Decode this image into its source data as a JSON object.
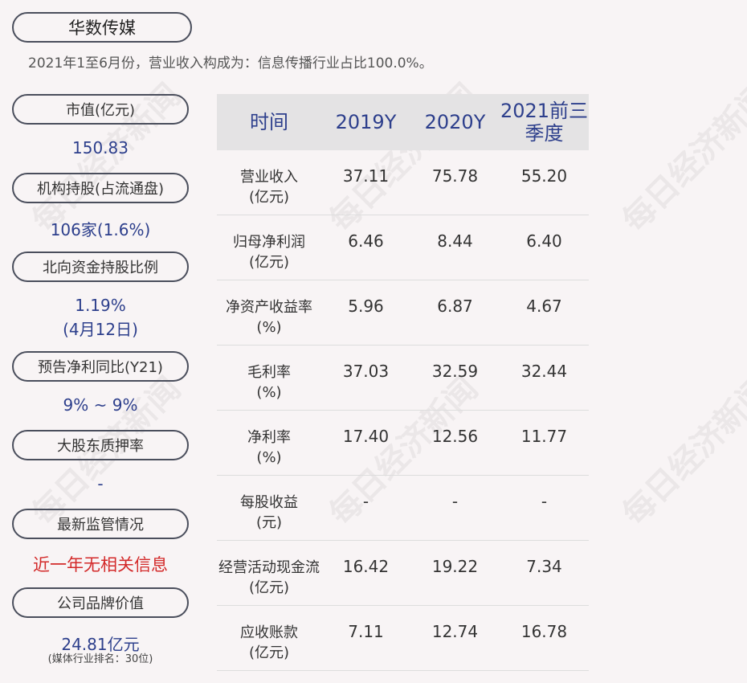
{
  "company": "华数传媒",
  "summary": "2021年1至6月份，营业收入构成为：信息传播行业占比100.0%。",
  "watermark": "每日经济新闻",
  "metrics": [
    {
      "label": "市值(亿元)",
      "value": "150.83"
    },
    {
      "label": "机构持股(占流通盘)",
      "value": "106家(1.6%)"
    },
    {
      "label": "北向资金持股比例",
      "value": "1.19%",
      "value2": "(4月12日)"
    },
    {
      "label": "预告净利同比(Y21)",
      "value": "9% ~ 9%"
    },
    {
      "label": "大股东质押率",
      "value": "-"
    },
    {
      "label": "最新监管情况",
      "value": "近一年无相关信息"
    },
    {
      "label": "公司品牌价值",
      "value": "24.81亿元",
      "note": "(媒体行业排名：30位)"
    }
  ],
  "table": {
    "headers": [
      "时间",
      "2019Y",
      "2020Y",
      "2021前三季度"
    ],
    "rows": [
      {
        "name": "营业收入",
        "unit": "(亿元)",
        "values": [
          "37.11",
          "75.78",
          "55.20"
        ]
      },
      {
        "name": "归母净利润",
        "unit": "(亿元)",
        "values": [
          "6.46",
          "8.44",
          "6.40"
        ]
      },
      {
        "name": "净资产收益率",
        "unit": "(%)",
        "values": [
          "5.96",
          "6.87",
          "4.67"
        ]
      },
      {
        "name": "毛利率",
        "unit": "(%)",
        "values": [
          "37.03",
          "32.59",
          "32.44"
        ]
      },
      {
        "name": "净利率",
        "unit": "(%)",
        "values": [
          "17.40",
          "12.56",
          "11.77"
        ]
      },
      {
        "name": "每股收益",
        "unit": "(元)",
        "values": [
          "-",
          "-",
          "-"
        ]
      },
      {
        "name": "经营活动现金流",
        "unit": "(亿元)",
        "values": [
          "16.42",
          "19.22",
          "7.34"
        ]
      },
      {
        "name": "应收账款",
        "unit": "(亿元)",
        "values": [
          "7.11",
          "12.74",
          "16.78"
        ]
      }
    ]
  },
  "colors": {
    "value_blue": "#2d3f8c",
    "alert_red": "#d32a2a",
    "header_bg": "#e4e3e4",
    "page_bg": "#f8f4f5"
  }
}
